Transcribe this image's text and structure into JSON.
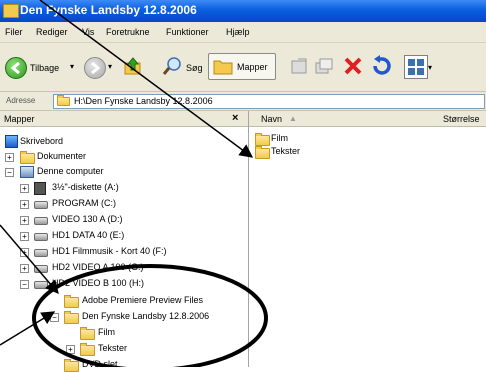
{
  "window": {
    "title": "Den Fynske Landsby 12.8.2006"
  },
  "menu": [
    "Filer",
    "Rediger",
    "Vis",
    "Foretrukne",
    "Funktioner",
    "Hjælp"
  ],
  "toolbar": {
    "back_label": "Tilbage",
    "search_label": "Søg",
    "folders_label": "Mapper"
  },
  "address": {
    "label": "Adresse",
    "value": "H:\\Den Fynske Landsby 12.8.2006"
  },
  "left_pane": {
    "header": "Mapper",
    "close": "×",
    "tree": [
      {
        "label": "Skrivebord"
      },
      {
        "label": "Dokumenter"
      },
      {
        "label": "Denne computer"
      },
      {
        "label": "3½\"-diskette (A:)"
      },
      {
        "label": "PROGRAM (C:)"
      },
      {
        "label": "VIDEO 130 A (D:)"
      },
      {
        "label": "HD1 DATA 40 (E:)"
      },
      {
        "label": "HD1 Filmmusik - Kort 40 (F:)"
      },
      {
        "label": "HD2 VIDEO A 100 (G:)"
      },
      {
        "label": "HD2 VIDEO B 100 (H:)"
      },
      {
        "label": "Adobe Premiere Preview Files"
      },
      {
        "label": "Den Fynske Landsby 12.8.2006"
      },
      {
        "label": "Film"
      },
      {
        "label": "Tekster"
      },
      {
        "label": "DVD slet"
      }
    ]
  },
  "right_pane": {
    "col_name": "Navn",
    "col_size": "Størrelse",
    "items": [
      {
        "label": "Film"
      },
      {
        "label": "Tekster"
      }
    ]
  },
  "colors": {
    "titlebar": "#0a5fe0",
    "chrome": "#ece9d8",
    "annotation": "#000000"
  }
}
